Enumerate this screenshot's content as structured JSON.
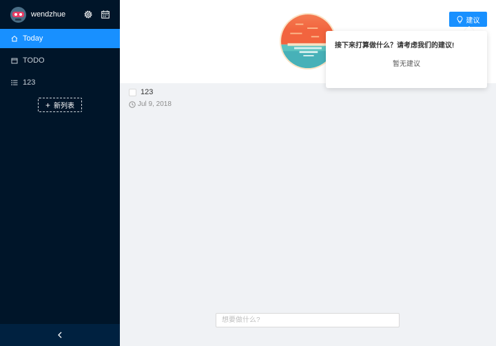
{
  "user": {
    "name": "wendzhue"
  },
  "sidebar": {
    "items": [
      {
        "label": "Today",
        "icon": "home-icon",
        "active": true
      },
      {
        "label": "TODO",
        "icon": "calendar-icon",
        "active": false
      },
      {
        "label": "123",
        "icon": "list-icon",
        "active": false
      }
    ],
    "new_list_label": "新列表"
  },
  "todos": [
    {
      "text": "123",
      "date": "Jul 9, 2018",
      "done": false
    }
  ],
  "input": {
    "placeholder": "想要做什么?"
  },
  "suggest": {
    "button_label": "建议",
    "title": "接下来打算做什么？请考虑我们的建议!",
    "empty_text": "暂无建议"
  },
  "colors": {
    "sidebar": "#001529",
    "accent": "#1890ff",
    "background": "#f0f2f5"
  }
}
